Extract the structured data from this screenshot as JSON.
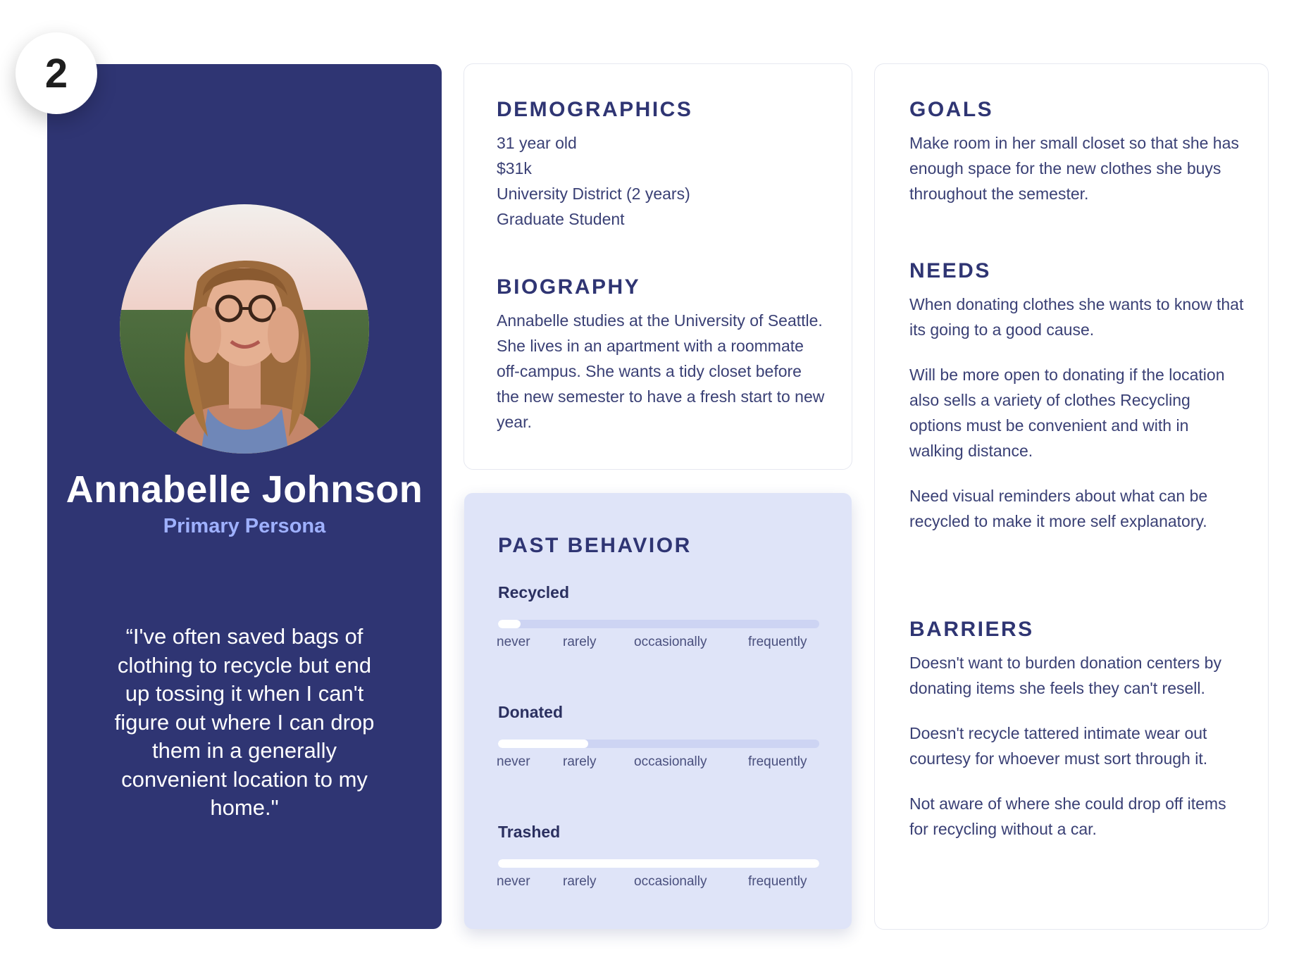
{
  "badge": {
    "number": "2"
  },
  "persona": {
    "name": "Annabelle Johnson",
    "role": "Primary Persona",
    "quote": "“I've often saved bags of clothing to recycle but end up tossing it when I can't figure out where I can drop them in a generally convenient location to my home.\"",
    "photo_icon": "portrait-photo"
  },
  "demographics": {
    "title": "DEMOGRAPHICS",
    "lines": [
      "31 year old",
      "$31k",
      "University District (2 years)",
      "Graduate Student"
    ]
  },
  "biography": {
    "title": "BIOGRAPHY",
    "text": "Annabelle studies at the University of Seattle. She lives in an apartment with a roommate off-campus. She wants a tidy closet before the new semester to have a fresh start to new year."
  },
  "past_behavior": {
    "title": "PAST BEHAVIOR",
    "scale_labels": [
      "never",
      "rarely",
      "occasionally",
      "frequently"
    ],
    "items": [
      {
        "label": "Recycled",
        "level": 0.07
      },
      {
        "label": "Donated",
        "level": 0.28
      },
      {
        "label": "Trashed",
        "level": 1.0
      }
    ]
  },
  "goals": {
    "title": "GOALS",
    "paragraphs": [
      "Make room in her small closet so that she has enough space for the new clothes she buys throughout the semester."
    ]
  },
  "needs": {
    "title": "NEEDS",
    "paragraphs": [
      "When donating clothes she wants to know that its going to a good cause.",
      "Will be more open to donating if the location also sells a variety of clothes Recycling options must be convenient and with in walking distance.",
      "Need visual reminders about what can be recycled to make it more self explanatory."
    ]
  },
  "barriers": {
    "title": "BARRIERS",
    "paragraphs": [
      "Doesn't want to burden donation centers by donating items she feels they can't resell.",
      "Doesn't recycle tattered intimate wear out courtesy for whoever must sort through it.",
      "Not aware of where she could drop off items for recycling without a car."
    ]
  },
  "colors": {
    "navy": "#2f3573",
    "accent": "#9fb1ff",
    "behavior_bg": "#dfe4f8",
    "track": "#cdd4f3"
  }
}
